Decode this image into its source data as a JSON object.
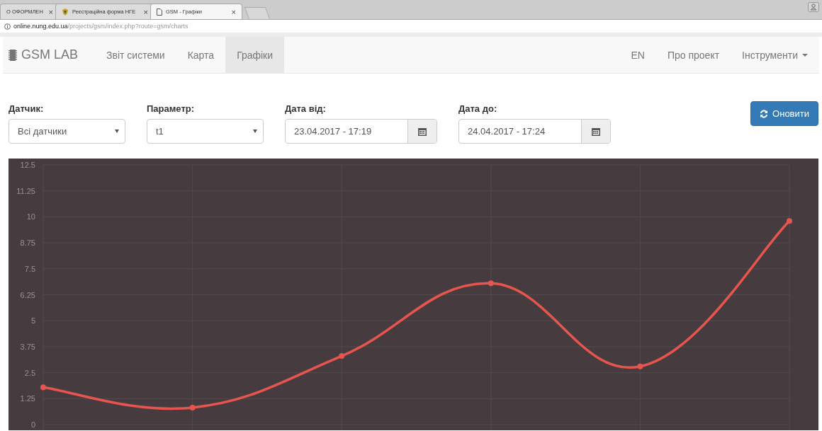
{
  "browser": {
    "tabs": [
      {
        "title": "О ОФОРМЛЕН",
        "close": "×",
        "selected": false,
        "kind": "plain"
      },
      {
        "title": "Реєстраційна форма НГЕ",
        "close": "×",
        "selected": false,
        "kind": "crest"
      },
      {
        "title": "GSM - Графіки",
        "close": "×",
        "selected": true,
        "kind": "page"
      }
    ],
    "address": {
      "host": "online.nung.edu.ua",
      "path": "/projects/gsm/index.php?route=gsm/charts"
    }
  },
  "navbar": {
    "brand": "GSM LAB",
    "items": [
      {
        "label": "Звіт системи",
        "selected": false
      },
      {
        "label": "Карта",
        "selected": false
      },
      {
        "label": "Графіки",
        "selected": true
      }
    ],
    "right_items": [
      {
        "label": "EN",
        "dropdown": false
      },
      {
        "label": "Про проект",
        "dropdown": false
      },
      {
        "label": "Інструменти",
        "dropdown": true
      }
    ]
  },
  "filters": [
    {
      "label": "Датчик:",
      "kind": "select",
      "value": "Всі датчики"
    },
    {
      "label": "Параметр:",
      "kind": "select",
      "value": "t1"
    },
    {
      "label": "Дата від:",
      "kind": "date",
      "value": "23.04.2017 - 17:19"
    },
    {
      "label": "Дата до:",
      "kind": "date",
      "value": "24.04.2017 - 17:24"
    }
  ],
  "refresh_button": "Оновити",
  "chart": {
    "chart_data": {
      "type": "line",
      "ylim": [
        0,
        12.5
      ],
      "yticks": [
        0,
        {
          "value": 1.25,
          "label": "1.25"
        },
        {
          "value": 2.5,
          "label": "2.5"
        },
        {
          "value": 3.75,
          "label": "3.75"
        },
        5,
        {
          "value": 6.25,
          "label": "6.25"
        },
        {
          "value": 7.5,
          "label": "7.5"
        },
        {
          "value": 8.75,
          "label": "8.75"
        },
        10,
        {
          "value": 11.25,
          "label": "11.25"
        },
        {
          "value": 12.5,
          "label": "12.5"
        }
      ],
      "grid": true,
      "series": [
        {
          "color": "#e8554e",
          "marker": true,
          "values": [
            1.8,
            0.82,
            3.3,
            6.8,
            2.8,
            9.8
          ]
        }
      ]
    }
  }
}
